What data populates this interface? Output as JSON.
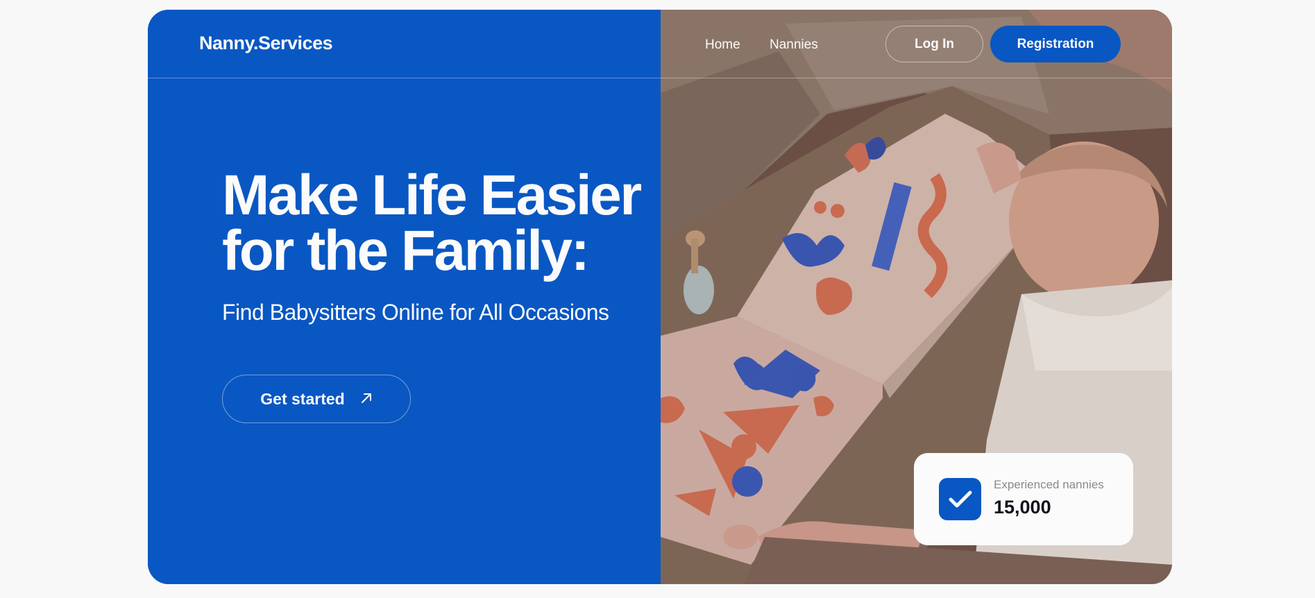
{
  "header": {
    "logo": "Nanny.Services",
    "nav": [
      "Home",
      "Nannies"
    ],
    "login_label": "Log In",
    "register_label": "Registration"
  },
  "hero": {
    "title_line1": "Make Life Easier",
    "title_line2": "for the Family:",
    "subtitle": "Find Babysitters Online for All Occasions",
    "cta_label": "Get started",
    "cta_icon": "arrow-up-right-icon"
  },
  "stat": {
    "label": "Experienced nannies",
    "value": "15,000",
    "icon": "check-icon"
  },
  "colors": {
    "brand": "#0957c3",
    "text_light": "#fbfbfb",
    "text_dark": "#11101c",
    "background": "#f8f8f9"
  },
  "image": {
    "icon": "baby-reading-book-photo"
  }
}
